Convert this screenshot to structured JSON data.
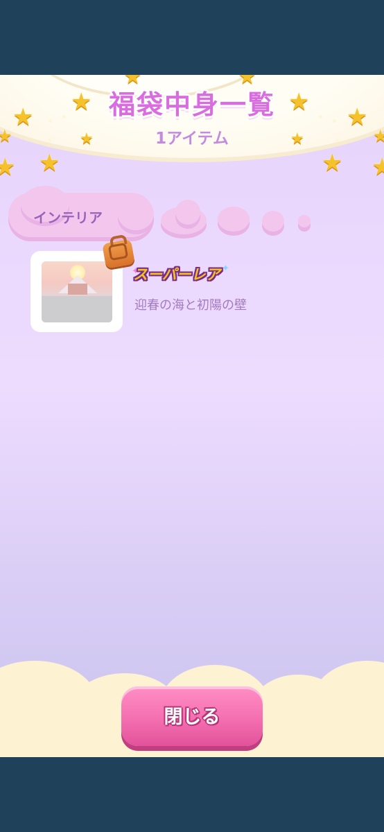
{
  "header": {
    "title": "福袋中身一覧",
    "subtitle": "1アイテム"
  },
  "category": {
    "label": "インテリア"
  },
  "items": [
    {
      "rarity": "スーパーレア",
      "name": "迎春の海と初陽の壁",
      "icon": "bag-icon"
    }
  ],
  "footer": {
    "close_label": "閉じる"
  },
  "colors": {
    "frame": "#1f4159",
    "title": "#d96de0",
    "button": "#f46fb0"
  }
}
